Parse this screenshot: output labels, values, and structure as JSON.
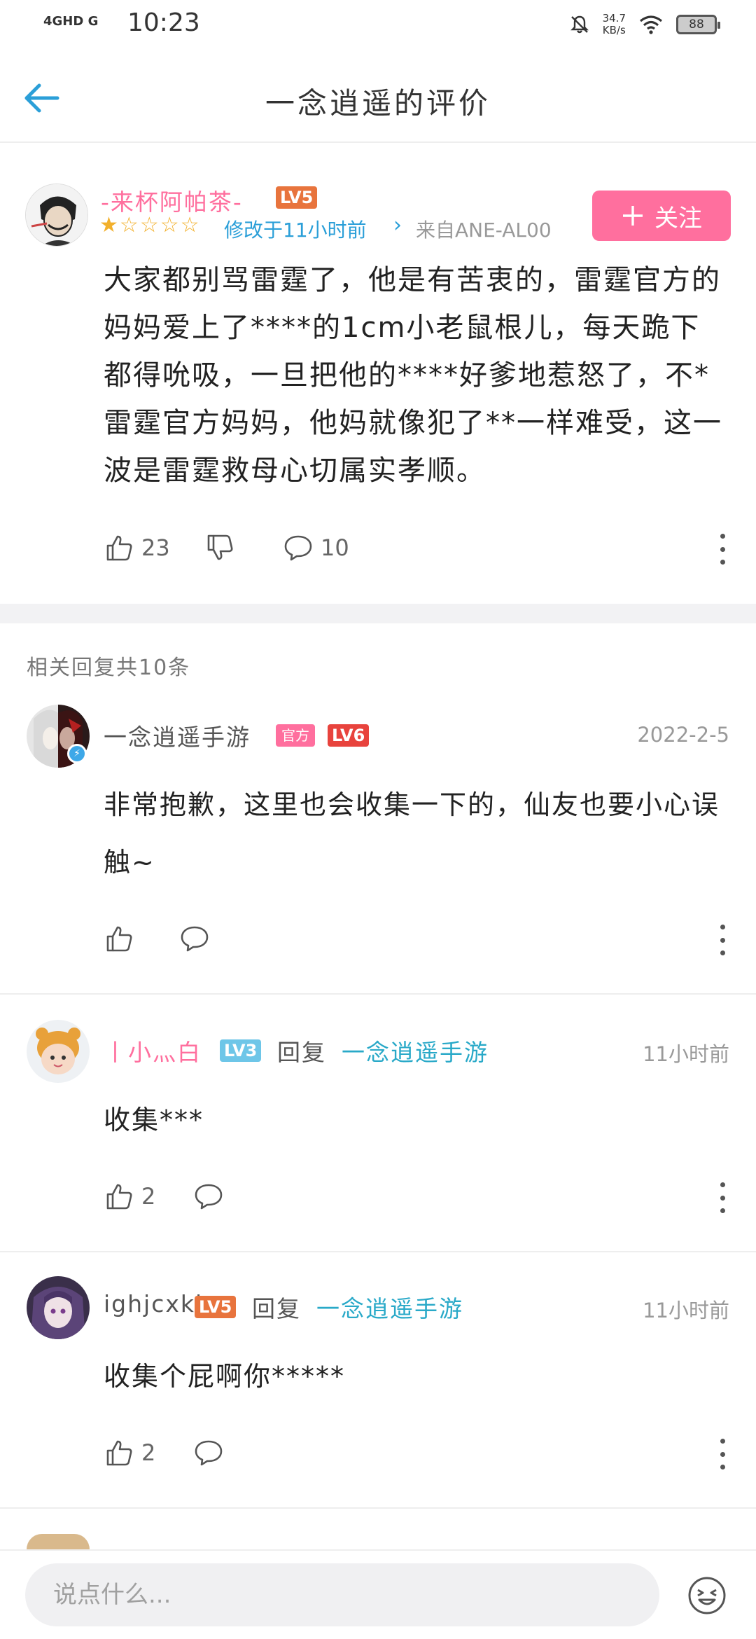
{
  "status_bar": {
    "network": "4GHD G",
    "time": "10:23",
    "speed_value": "34.7",
    "speed_unit": "KB/s",
    "battery": "88"
  },
  "header": {
    "title": "一念逍遥的评价",
    "back_icon": "back-arrow-icon"
  },
  "review": {
    "author": "-来杯阿帕茶-",
    "level": "LV5",
    "follow_label": "关注",
    "rating": 1,
    "rating_max": 5,
    "modified": "修改于11小时前",
    "from": "来自ANE-AL00",
    "text": "大家都别骂雷霆了，他是有苦衷的，雷霆官方的妈妈爱上了****的1cm小老鼠根儿，每天跪下都得吮吸，一旦把他的****好爹地惹怒了，不*雷霆官方妈妈，他妈就像犯了**一样难受，这一波是雷霆救母心切属实孝顺。",
    "likes": "23",
    "comments": "10"
  },
  "replies_header": "相关回复共10条",
  "replies": [
    {
      "author": "一念逍遥手游",
      "official_tag": "官方",
      "level": "LV6",
      "date": "2022-2-5",
      "text": "非常抱歉，这里也会收集一下的，仙友也要小心误触~",
      "likes": ""
    },
    {
      "author": "丨小灬白",
      "level": "LV3",
      "reply_word": "回复",
      "reply_to": "一念逍遥手游",
      "date": "11小时前",
      "text": "收集***",
      "likes": "2"
    },
    {
      "author": "ighjcxkl",
      "level": "LV5",
      "reply_word": "回复",
      "reply_to": "一念逍遥手游",
      "date": "11小时前",
      "text": "收集个屁啊你*****",
      "likes": "2"
    }
  ],
  "bottom_bar": {
    "placeholder": "说点什么..."
  },
  "colors": {
    "accent_blue": "#2b9fd8",
    "pink": "#ff6f9e",
    "star": "#f2b02c"
  }
}
